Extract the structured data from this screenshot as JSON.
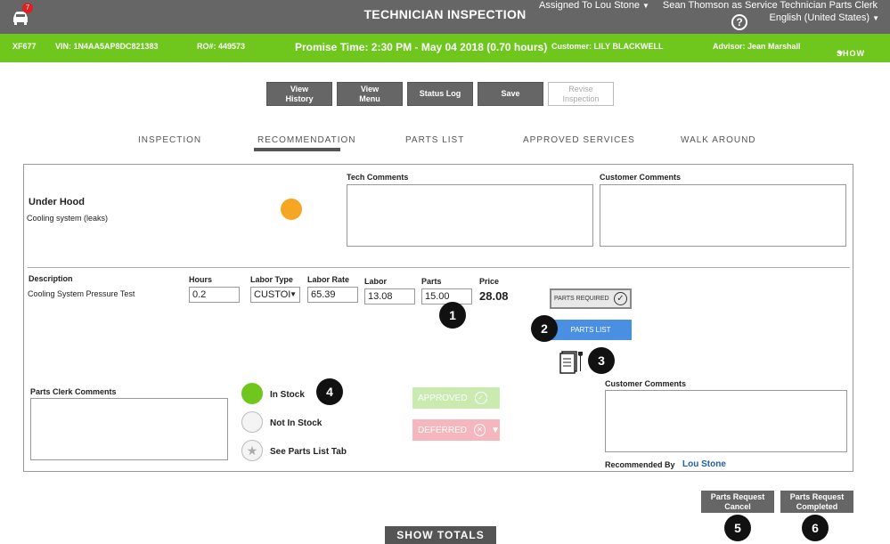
{
  "header": {
    "title": "TECHNICIAN INSPECTION",
    "notification_count": "7",
    "assigned_to": "Assigned To Lou Stone",
    "user_role": "Sean Thomson as Service Technician Parts Clerk",
    "help": "?",
    "language": "English (United States)"
  },
  "vehicle_bar": {
    "tag": "XF677",
    "vin": "VIN: 1N4AA5AP8DC821383",
    "ro": "RO#: 449573",
    "promise": "Promise Time: 2:30 PM - May 04 2018 (0.70 hours)",
    "customer": "Customer: LILY BLACKWELL",
    "advisor": "Advisor: Jean Marshall",
    "show": "SHOW"
  },
  "toolbar": {
    "view_history_1": "View",
    "view_history_2": "History",
    "view_menu_1": "View",
    "view_menu_2": "Menu",
    "status_log": "Status Log",
    "save": "Save",
    "revise_1": "Revise",
    "revise_2": "Inspection"
  },
  "tabs": [
    "INSPECTION",
    "RECOMMENDATION",
    "PARTS LIST",
    "APPROVED SERVICES",
    "WALK AROUND"
  ],
  "item": {
    "section": "Under Hood",
    "subtitle": "Cooling system (leaks)",
    "status_color": "#f5a623",
    "tech_comments_label": "Tech Comments",
    "customer_comments_label": "Customer Comments"
  },
  "line": {
    "description_label": "Description",
    "description": "Cooling System Pressure Test",
    "hours_label": "Hours",
    "hours": "0.2",
    "labor_type_label": "Labor Type",
    "labor_type": "CUSTOI",
    "labor_rate_label": "Labor Rate",
    "labor_rate": "65.39",
    "labor_label": "Labor",
    "labor": "13.08",
    "parts_label": "Parts",
    "parts": "15.00",
    "price_label": "Price",
    "price": "28.08",
    "parts_required": "PARTS REQUIRED",
    "parts_list_btn": "PARTS LIST"
  },
  "parts_clerk": {
    "comments_label": "Parts Clerk Comments",
    "in_stock": "In Stock",
    "not_in_stock": "Not In Stock",
    "see_parts_list": "See Parts List Tab",
    "approved": "APPROVED",
    "deferred": "DEFERRED",
    "customer_comments_label": "Customer Comments",
    "recommended_by_label": "Recommended By",
    "recommended_by": "Lou Stone"
  },
  "markers": [
    "1",
    "2",
    "3",
    "4",
    "5",
    "6"
  ],
  "bottom": {
    "cancel_1": "Parts Request",
    "cancel_2": "Cancel",
    "completed_1": "Parts Request",
    "completed_2": "Completed",
    "show_totals": "SHOW TOTALS"
  }
}
